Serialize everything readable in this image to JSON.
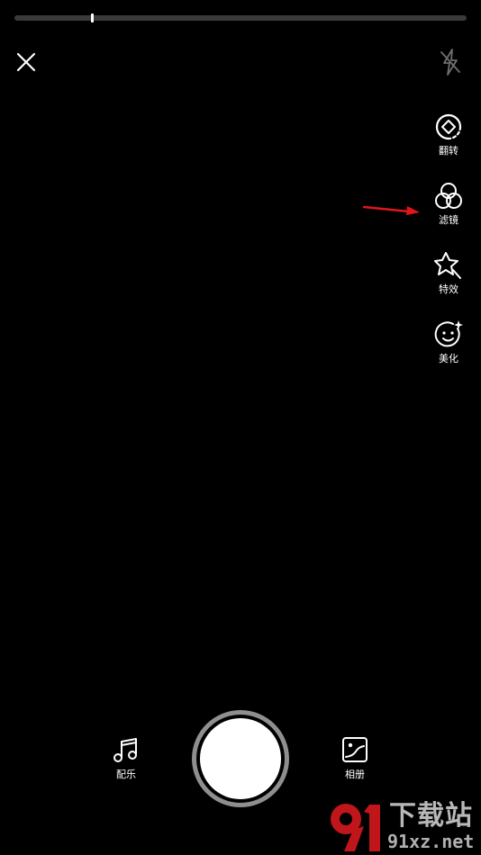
{
  "progress": {
    "recorded_fraction": 0.17
  },
  "top_bar": {
    "close_icon": "close-icon",
    "flash_icon": "flash-off-icon"
  },
  "tools": [
    {
      "id": "flip",
      "label": "翻转",
      "icon": "camera-flip-icon"
    },
    {
      "id": "filter",
      "label": "滤镜",
      "icon": "filter-icon"
    },
    {
      "id": "effects",
      "label": "特效",
      "icon": "effects-star-icon"
    },
    {
      "id": "beauty",
      "label": "美化",
      "icon": "beauty-face-icon"
    }
  ],
  "bottom": {
    "music_label": "配乐",
    "music_icon": "music-note-icon",
    "album_label": "相册",
    "album_icon": "photo-album-icon",
    "shutter_icon": "shutter-icon"
  },
  "annotation": {
    "arrow_color": "#e0161b"
  },
  "watermark": {
    "title": "下载站",
    "url": "91xz.net",
    "logo_color": "#c0161b"
  }
}
